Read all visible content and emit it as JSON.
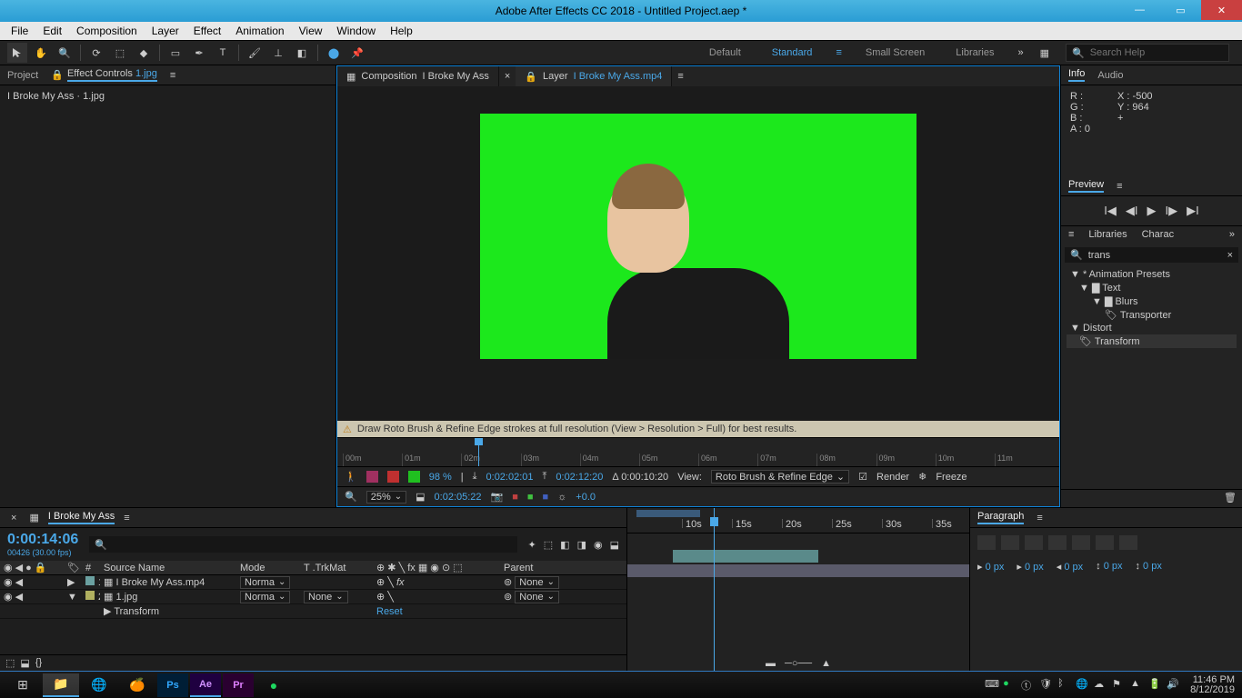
{
  "titlebar": {
    "text": "Adobe After Effects CC 2018 - Untitled Project.aep *"
  },
  "menu": [
    "File",
    "Edit",
    "Composition",
    "Layer",
    "Effect",
    "Animation",
    "View",
    "Window",
    "Help"
  ],
  "workspaces": {
    "items": [
      "Default",
      "Standard",
      "Small Screen",
      "Libraries"
    ],
    "active": 1
  },
  "search_help": {
    "placeholder": "Search Help"
  },
  "project_panel": {
    "tabs": [
      "Project",
      "Effect Controls"
    ],
    "fx_target": "1.jpg",
    "breadcrumb": "I Broke My Ass · 1.jpg"
  },
  "composition_tabs": {
    "comp": {
      "label": "Composition",
      "name": "I Broke My Ass"
    },
    "layer": {
      "label": "Layer",
      "name": "I Broke My Ass.mp4"
    }
  },
  "warning": "Draw Roto Brush & Refine Edge strokes at full resolution (View > Resolution > Full) for best results.",
  "mini_ruler": [
    "00m",
    "01m",
    "02m",
    "03m",
    "04m",
    "05m",
    "06m",
    "07m",
    "08m",
    "09m",
    "10m",
    "11m"
  ],
  "roto": {
    "percent": "98 %",
    "t1": "0:02:02:01",
    "t2": "0:02:12:20",
    "delta": "Δ 0:00:10:20",
    "view_label": "View:",
    "view_sel": "Roto Brush & Refine Edge",
    "render": "Render",
    "freeze": "Freeze"
  },
  "viewer_ctrl": {
    "zoom": "25%",
    "time": "0:02:05:22",
    "offset": "+0.0"
  },
  "info_panel": {
    "tabs": [
      "Info",
      "Audio"
    ],
    "R": "R :",
    "G": "G :",
    "B": "B :",
    "A": "A :  0",
    "X": "X : -500",
    "Y": "Y :  964"
  },
  "preview_panel": {
    "title": "Preview"
  },
  "effects_panel": {
    "tabs": [
      "Libraries",
      "Charac"
    ],
    "search": "trans",
    "tree": [
      {
        "l": "* Animation Presets",
        "i": 0
      },
      {
        "l": "Text",
        "i": 1
      },
      {
        "l": "Blurs",
        "i": 2
      },
      {
        "l": "Transporter",
        "i": 3
      },
      {
        "l": "Distort",
        "i": 0
      },
      {
        "l": "Transform",
        "i": 1,
        "sel": true
      }
    ]
  },
  "timeline": {
    "comp_name": "I Broke My Ass",
    "timecode": "0:00:14:06",
    "sub": "00426 (30.00 fps)",
    "cols": [
      "#",
      "Source Name",
      "Mode",
      "T .TrkMat",
      "Parent"
    ],
    "layers": [
      {
        "n": "1",
        "name": "I Broke My Ass.mp4",
        "mode": "Norma",
        "trk": "",
        "parent": "None",
        "color": "#6aa0a0"
      },
      {
        "n": "2",
        "name": "1.jpg",
        "mode": "Norma",
        "trk": "None",
        "parent": "None",
        "color": "#b0b060"
      }
    ],
    "transform_row": "Transform",
    "transform_reset": "Reset",
    "ruler": [
      "10s",
      "15s",
      "20s",
      "25s",
      "30s",
      "35s"
    ]
  },
  "paragraph": {
    "title": "Paragraph",
    "px": "0 px"
  },
  "taskbar": {
    "clock_time": "11:46 PM",
    "clock_date": "8/12/2019"
  }
}
